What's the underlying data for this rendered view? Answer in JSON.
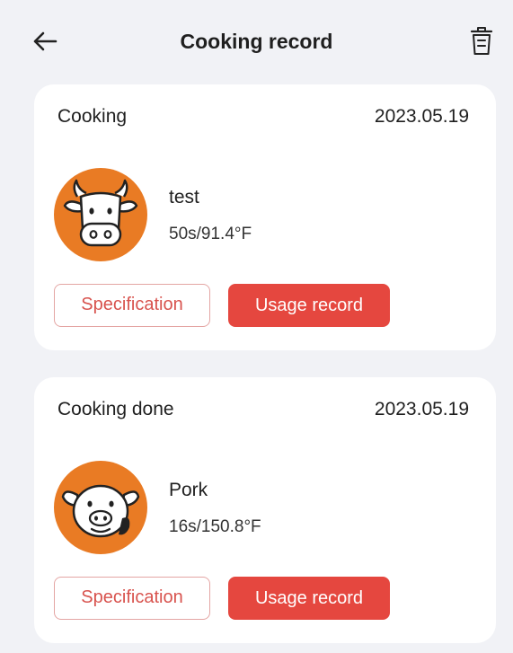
{
  "header": {
    "title": "Cooking record",
    "back_icon": "arrow-left-icon",
    "trash_icon": "trash-icon"
  },
  "records": [
    {
      "status": "Cooking",
      "date": "2023.05.19",
      "icon": "cow-icon",
      "name": "test",
      "detail": "50s/91.4°F",
      "spec_label": "Specification",
      "usage_label": "Usage record"
    },
    {
      "status": "Cooking done",
      "date": "2023.05.19",
      "icon": "pig-icon",
      "name": "Pork",
      "detail": "16s/150.8°F",
      "spec_label": "Specification",
      "usage_label": "Usage record"
    }
  ],
  "colors": {
    "background": "#f1f2f6",
    "card": "#ffffff",
    "accent": "#e5473f",
    "avatar": "#e97b24"
  }
}
